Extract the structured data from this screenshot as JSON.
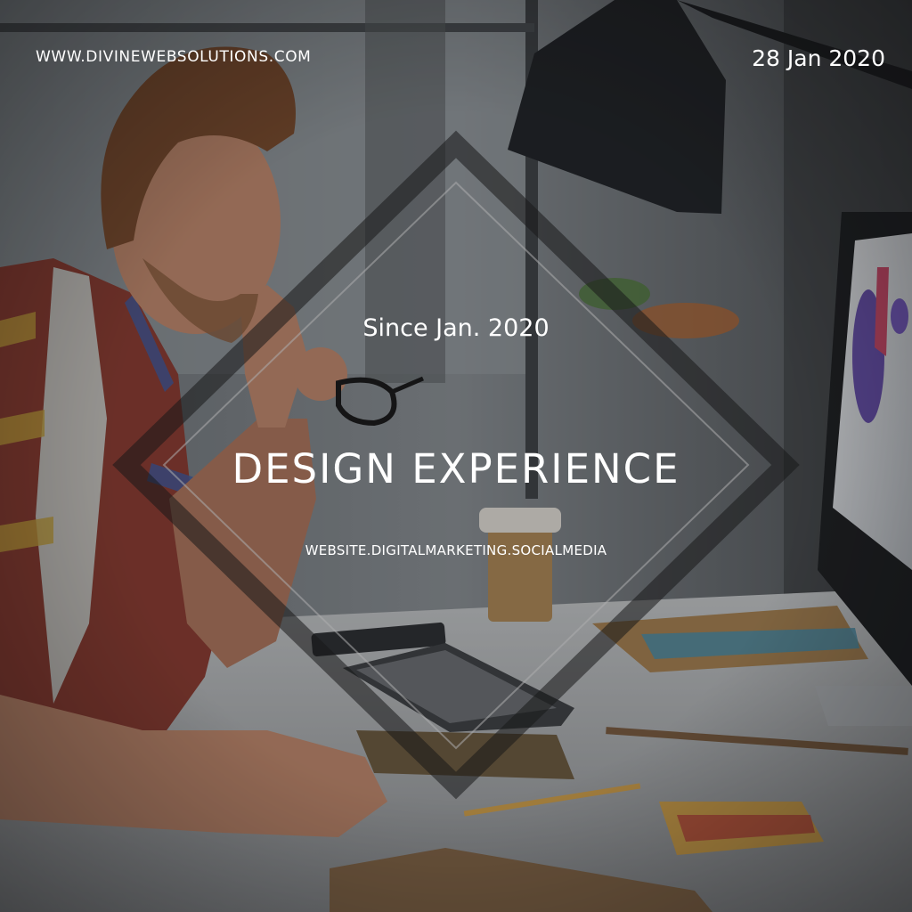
{
  "header": {
    "website": "WWW.DIVINEWEBSOLUTIONS.COM",
    "date": "28 Jan 2020"
  },
  "center": {
    "since": "Since Jan. 2020",
    "headline": "DESIGN EXPERIENCE",
    "services": "WEBSITE.DIGITALMARKETING.SOCIALMEDIA"
  },
  "colors": {
    "text": "#ffffff",
    "overlay": "#1a1c1e"
  }
}
